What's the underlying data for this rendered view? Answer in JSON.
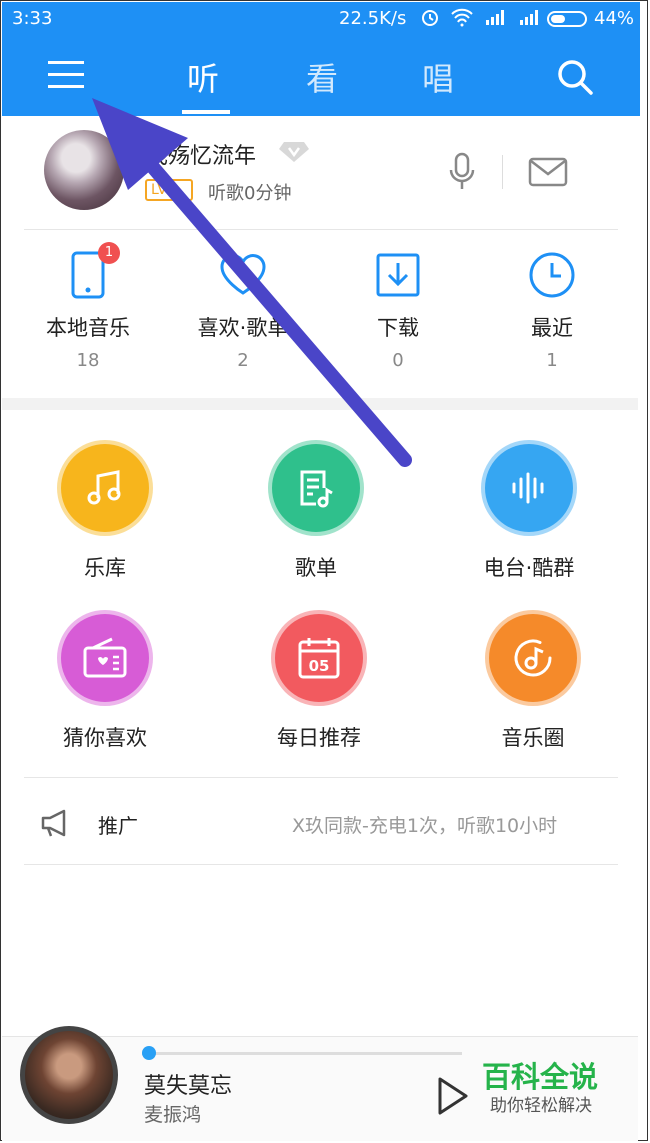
{
  "status_bar": {
    "time": "3:33",
    "speed": "22.5K/s",
    "battery_pct": "44%",
    "battery_level": 0.44
  },
  "header": {
    "tabs": [
      {
        "label": "听",
        "active": true
      },
      {
        "label": "看",
        "active": false
      },
      {
        "label": "唱",
        "active": false
      }
    ],
    "accent": "#1e90f5"
  },
  "profile": {
    "name": "浅殇忆流年",
    "level": "LV0",
    "listen_time": "听歌0分钟"
  },
  "quick_access": [
    {
      "label": "本地音乐",
      "count": "18",
      "badge": "1"
    },
    {
      "label": "喜欢·歌单",
      "count": "2"
    },
    {
      "label": "下载",
      "count": "0"
    },
    {
      "label": "最近",
      "count": "1"
    }
  ],
  "features": [
    {
      "label": "乐库",
      "color": "#f7b51c"
    },
    {
      "label": "歌单",
      "color": "#2fc08c"
    },
    {
      "label": "电台·酷群",
      "color": "#36a6f2"
    },
    {
      "label": "猜你喜欢",
      "color": "#d75cd6"
    },
    {
      "label": "每日推荐",
      "color": "#f25a5f"
    },
    {
      "label": "音乐圈",
      "color": "#f58a2a"
    }
  ],
  "daily_icon_text": "05",
  "promo": {
    "label": "推广",
    "text": "X玖同款-充电1次，听歌10小时"
  },
  "player": {
    "song": "莫失莫忘",
    "artist": "麦振鸿",
    "progress": 0.02
  },
  "watermark": {
    "title": "百科全说",
    "subtitle": "助你轻松解决"
  }
}
